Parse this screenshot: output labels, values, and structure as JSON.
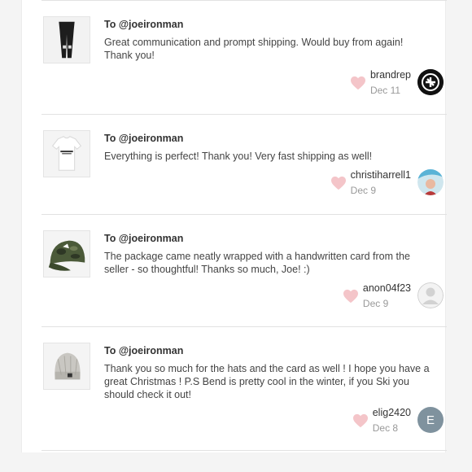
{
  "reviews": [
    {
      "to": "To @joeironman",
      "text": "Great communication and prompt shipping. Would buy from again! Thank you!",
      "user": "brandrep",
      "date": "Dec 11",
      "thumb": "black-pants-image",
      "avatar": "logo-avatar"
    },
    {
      "to": "To @joeironman",
      "text": "Everything is perfect! Thank you! Very fast shipping as well!",
      "user": "christiharrell1",
      "date": "Dec 9",
      "thumb": "white-tshirt-image",
      "avatar": "photo-avatar"
    },
    {
      "to": "To @joeironman",
      "text": "The package came neatly wrapped with a handwritten card from the seller - so thoughtful! Thanks so much, Joe! :)",
      "user": "anon04f23",
      "date": "Dec 9",
      "thumb": "camo-cap-image",
      "avatar": "default-avatar"
    },
    {
      "to": "To @joeironman",
      "text": "Thank you so much for the hats and the card as well ! I hope you have a great Christmas ! P.S Bend is pretty cool in the winter, if you Ski you should check it out!",
      "user": "elig2420",
      "date": "Dec 8",
      "thumb": "grey-beanie-image",
      "avatar": "letter-avatar",
      "avatar_letter": "E"
    }
  ],
  "colors": {
    "heart": "#f4c5c9",
    "avatar_letter_bg": "#7f929e",
    "divider": "#e2e2e2"
  }
}
